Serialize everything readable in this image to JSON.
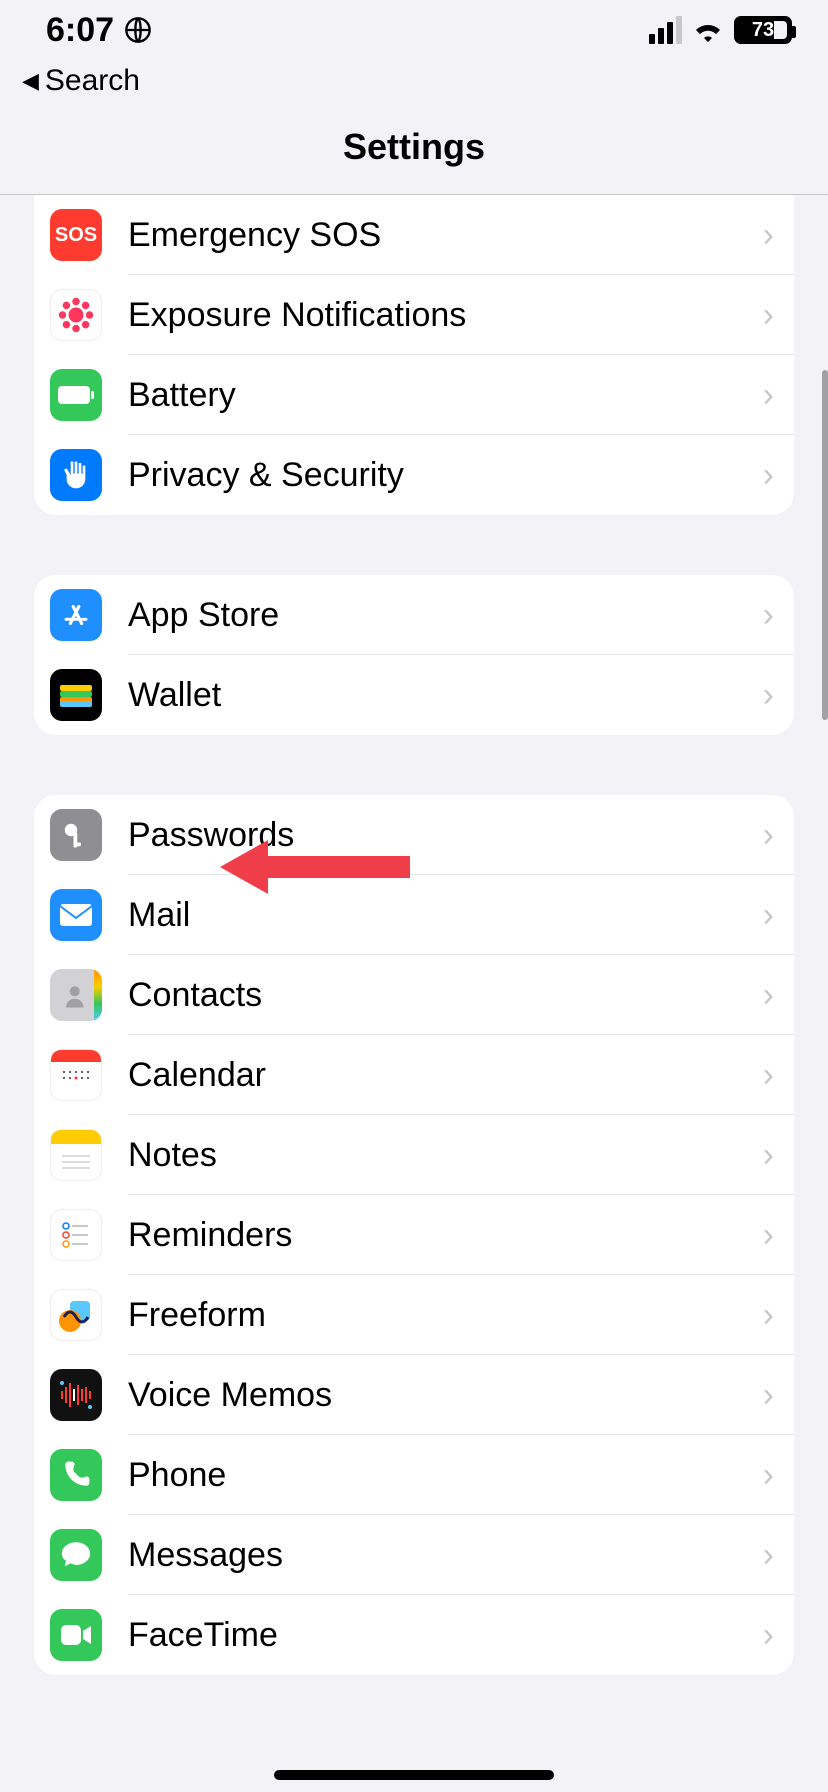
{
  "statusbar": {
    "time": "6:07",
    "battery_pct": "73"
  },
  "back_label": "Search",
  "page_title": "Settings",
  "sections": [
    {
      "rows": [
        {
          "icon": "sos",
          "label": "Emergency SOS"
        },
        {
          "icon": "exposure",
          "label": "Exposure Notifications"
        },
        {
          "icon": "battery",
          "label": "Battery"
        },
        {
          "icon": "privacy",
          "label": "Privacy & Security"
        }
      ]
    },
    {
      "rows": [
        {
          "icon": "appstore",
          "label": "App Store"
        },
        {
          "icon": "wallet",
          "label": "Wallet"
        }
      ]
    },
    {
      "rows": [
        {
          "icon": "passwords",
          "label": "Passwords"
        },
        {
          "icon": "mail",
          "label": "Mail"
        },
        {
          "icon": "contacts",
          "label": "Contacts"
        },
        {
          "icon": "calendar",
          "label": "Calendar"
        },
        {
          "icon": "notes",
          "label": "Notes"
        },
        {
          "icon": "reminders",
          "label": "Reminders"
        },
        {
          "icon": "freeform",
          "label": "Freeform"
        },
        {
          "icon": "voicememos",
          "label": "Voice Memos"
        },
        {
          "icon": "phone",
          "label": "Phone"
        },
        {
          "icon": "messages",
          "label": "Messages"
        },
        {
          "icon": "facetime",
          "label": "FaceTime"
        }
      ]
    }
  ],
  "annotation": {
    "target_row": "mail",
    "color": "#ef3e4a"
  }
}
